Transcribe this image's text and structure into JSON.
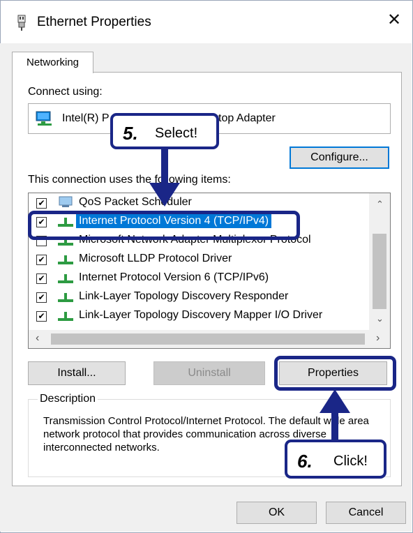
{
  "window": {
    "title": "Ethernet Properties",
    "close_glyph": "✕"
  },
  "tabs": [
    {
      "label": "Networking"
    }
  ],
  "connect_using": {
    "label": "Connect using:",
    "adapter_prefix": "Intel(R) P",
    "adapter_suffix": "top Adapter"
  },
  "buttons": {
    "configure": "Configure...",
    "install": "Install...",
    "uninstall": "Uninstall",
    "properties": "Properties",
    "ok": "OK",
    "cancel": "Cancel"
  },
  "items_label": "This connection uses the following items:",
  "items": [
    {
      "label": "QoS Packet Scheduler",
      "checked": true,
      "selected": false
    },
    {
      "label": "Internet Protocol Version 4 (TCP/IPv4)",
      "checked": true,
      "selected": true
    },
    {
      "label": "Microsoft Network Adapter Multiplexor Protocol",
      "checked": false,
      "selected": false
    },
    {
      "label": "Microsoft LLDP Protocol Driver",
      "checked": true,
      "selected": false
    },
    {
      "label": "Internet Protocol Version 6 (TCP/IPv6)",
      "checked": true,
      "selected": false
    },
    {
      "label": "Link-Layer Topology Discovery Responder",
      "checked": true,
      "selected": false
    },
    {
      "label": "Link-Layer Topology Discovery Mapper I/O Driver",
      "checked": true,
      "selected": false
    }
  ],
  "description": {
    "label": "Description",
    "text": "Transmission Control Protocol/Internet Protocol. The default wide area network protocol that provides communication across diverse interconnected networks."
  },
  "annotations": {
    "step5_num": "5.",
    "step5_text": "Select!",
    "step6_num": "6.",
    "step6_text": "Click!",
    "color": "#1a2687"
  },
  "colors": {
    "selection": "#0078d7",
    "dialog_bg": "#f0f0f0"
  }
}
